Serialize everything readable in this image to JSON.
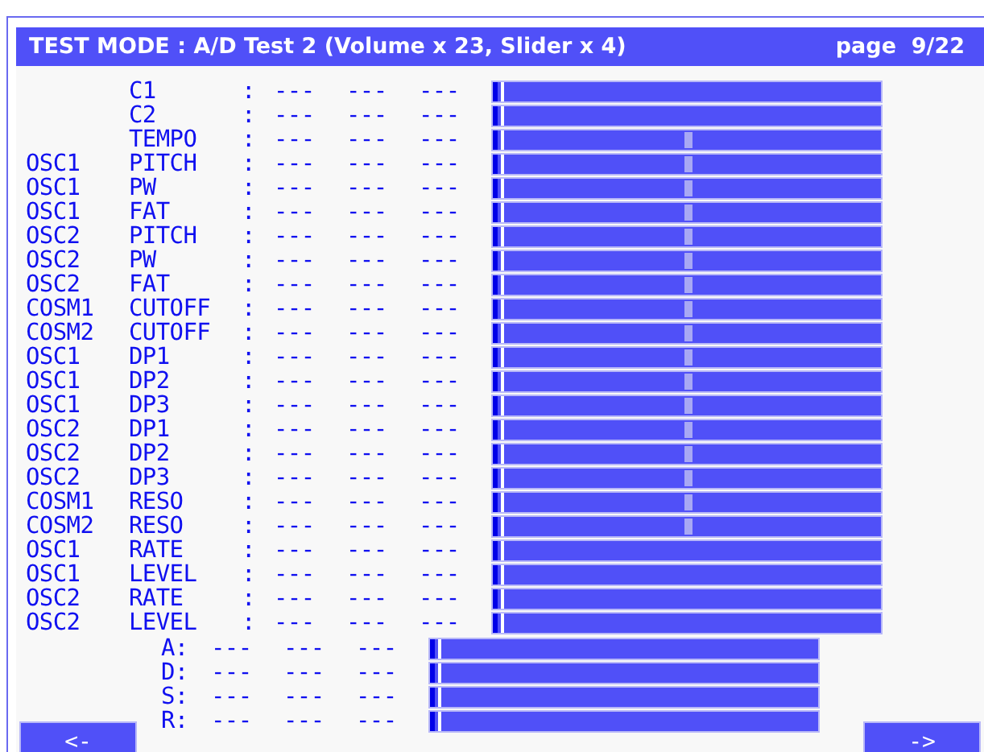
{
  "title_bar": {
    "title": "TEST MODE : A/D Test 2 (Volume x 23, Slider x 4)",
    "page": "page  9/22"
  },
  "rows": [
    {
      "group": "",
      "param": "C1",
      "sep": ":",
      "values": [
        "---",
        "---",
        "---"
      ],
      "level": 0,
      "center_mark": false
    },
    {
      "group": "",
      "param": "C2",
      "sep": ":",
      "values": [
        "---",
        "---",
        "---"
      ],
      "level": 0,
      "center_mark": false
    },
    {
      "group": "",
      "param": "TEMPO",
      "sep": ":",
      "values": [
        "---",
        "---",
        "---"
      ],
      "level": 0,
      "center_mark": true
    },
    {
      "group": "OSC1",
      "param": "PITCH",
      "sep": ":",
      "values": [
        "---",
        "---",
        "---"
      ],
      "level": 0,
      "center_mark": true
    },
    {
      "group": "OSC1",
      "param": "PW",
      "sep": ":",
      "values": [
        "---",
        "---",
        "---"
      ],
      "level": 0,
      "center_mark": true
    },
    {
      "group": "OSC1",
      "param": "FAT",
      "sep": ":",
      "values": [
        "---",
        "---",
        "---"
      ],
      "level": 0,
      "center_mark": true
    },
    {
      "group": "OSC2",
      "param": "PITCH",
      "sep": ":",
      "values": [
        "---",
        "---",
        "---"
      ],
      "level": 0,
      "center_mark": true
    },
    {
      "group": "OSC2",
      "param": "PW",
      "sep": ":",
      "values": [
        "---",
        "---",
        "---"
      ],
      "level": 0,
      "center_mark": true
    },
    {
      "group": "OSC2",
      "param": "FAT",
      "sep": ":",
      "values": [
        "---",
        "---",
        "---"
      ],
      "level": 0,
      "center_mark": true
    },
    {
      "group": "COSM1",
      "param": "CUTOFF",
      "sep": ":",
      "values": [
        "---",
        "---",
        "---"
      ],
      "level": 0,
      "center_mark": true
    },
    {
      "group": "COSM2",
      "param": "CUTOFF",
      "sep": ":",
      "values": [
        "---",
        "---",
        "---"
      ],
      "level": 0,
      "center_mark": true
    },
    {
      "group": "OSC1",
      "param": "DP1",
      "sep": ":",
      "values": [
        "---",
        "---",
        "---"
      ],
      "level": 0,
      "center_mark": true
    },
    {
      "group": "OSC1",
      "param": "DP2",
      "sep": ":",
      "values": [
        "---",
        "---",
        "---"
      ],
      "level": 0,
      "center_mark": true
    },
    {
      "group": "OSC1",
      "param": "DP3",
      "sep": ":",
      "values": [
        "---",
        "---",
        "---"
      ],
      "level": 0,
      "center_mark": true
    },
    {
      "group": "OSC2",
      "param": "DP1",
      "sep": ":",
      "values": [
        "---",
        "---",
        "---"
      ],
      "level": 0,
      "center_mark": true
    },
    {
      "group": "OSC2",
      "param": "DP2",
      "sep": ":",
      "values": [
        "---",
        "---",
        "---"
      ],
      "level": 0,
      "center_mark": true
    },
    {
      "group": "OSC2",
      "param": "DP3",
      "sep": ":",
      "values": [
        "---",
        "---",
        "---"
      ],
      "level": 0,
      "center_mark": true
    },
    {
      "group": "COSM1",
      "param": "RESO",
      "sep": ":",
      "values": [
        "---",
        "---",
        "---"
      ],
      "level": 0,
      "center_mark": true
    },
    {
      "group": "COSM2",
      "param": "RESO",
      "sep": ":",
      "values": [
        "---",
        "---",
        "---"
      ],
      "level": 0,
      "center_mark": true
    },
    {
      "group": "OSC1",
      "param": "RATE",
      "sep": ":",
      "values": [
        "---",
        "---",
        "---"
      ],
      "level": 0,
      "center_mark": false
    },
    {
      "group": "OSC1",
      "param": "LEVEL",
      "sep": ":",
      "values": [
        "---",
        "---",
        "---"
      ],
      "level": 0,
      "center_mark": false
    },
    {
      "group": "OSC2",
      "param": "RATE",
      "sep": ":",
      "values": [
        "---",
        "---",
        "---"
      ],
      "level": 0,
      "center_mark": false
    },
    {
      "group": "OSC2",
      "param": "LEVEL",
      "sep": ":",
      "values": [
        "---",
        "---",
        "---"
      ],
      "level": 0,
      "center_mark": false
    }
  ],
  "envelope_rows": [
    {
      "label": "A:",
      "values": [
        "---",
        "---",
        "---"
      ],
      "level": 0
    },
    {
      "label": "D:",
      "values": [
        "---",
        "---",
        "---"
      ],
      "level": 0
    },
    {
      "label": "S:",
      "values": [
        "---",
        "---",
        "---"
      ],
      "level": 0
    },
    {
      "label": "R:",
      "values": [
        "---",
        "---",
        "---"
      ],
      "level": 0
    }
  ],
  "buttons": {
    "previous": "<-",
    "next": "->"
  }
}
